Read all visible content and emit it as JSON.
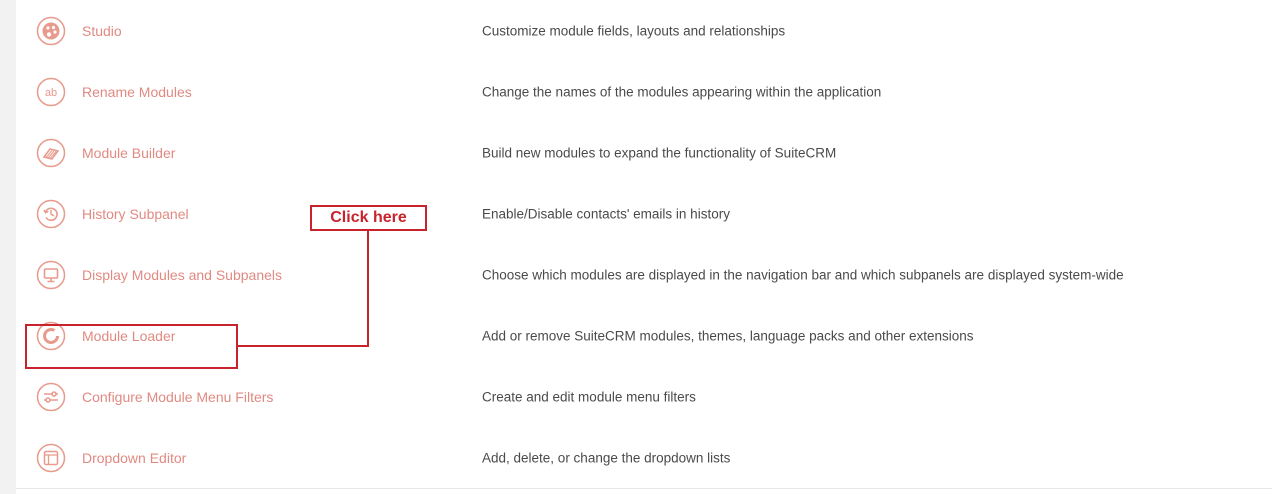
{
  "colors": {
    "link": "#e08a82",
    "icon": "#e89a8c",
    "description": "#4a4a4a",
    "annotation": "#c8232c"
  },
  "rows": [
    {
      "label": "Studio",
      "description": "Customize module fields, layouts and relationships",
      "icon": "palette-icon"
    },
    {
      "label": "Rename Modules",
      "description": "Change the names of the modules appearing within the application",
      "icon": "ab-text-icon"
    },
    {
      "label": "Module Builder",
      "description": "Build new modules to expand the functionality of SuiteCRM",
      "icon": "module-builder-icon"
    },
    {
      "label": "History Subpanel",
      "description": "Enable/Disable contacts' emails in history",
      "icon": "history-icon"
    },
    {
      "label": "Display Modules and Subpanels",
      "description": "Choose which modules are displayed in the navigation bar and which subpanels are displayed system-wide",
      "icon": "monitor-icon"
    },
    {
      "label": "Module Loader",
      "description": "Add or remove SuiteCRM modules, themes, language packs and other extensions",
      "icon": "module-loader-icon"
    },
    {
      "label": "Configure Module Menu Filters",
      "description": "Create and edit module menu filters",
      "icon": "filter-sliders-icon"
    },
    {
      "label": "Dropdown Editor",
      "description": "Add, delete, or change the dropdown lists",
      "icon": "dropdown-editor-icon"
    }
  ],
  "annotation": {
    "callout_text": "Click here"
  }
}
